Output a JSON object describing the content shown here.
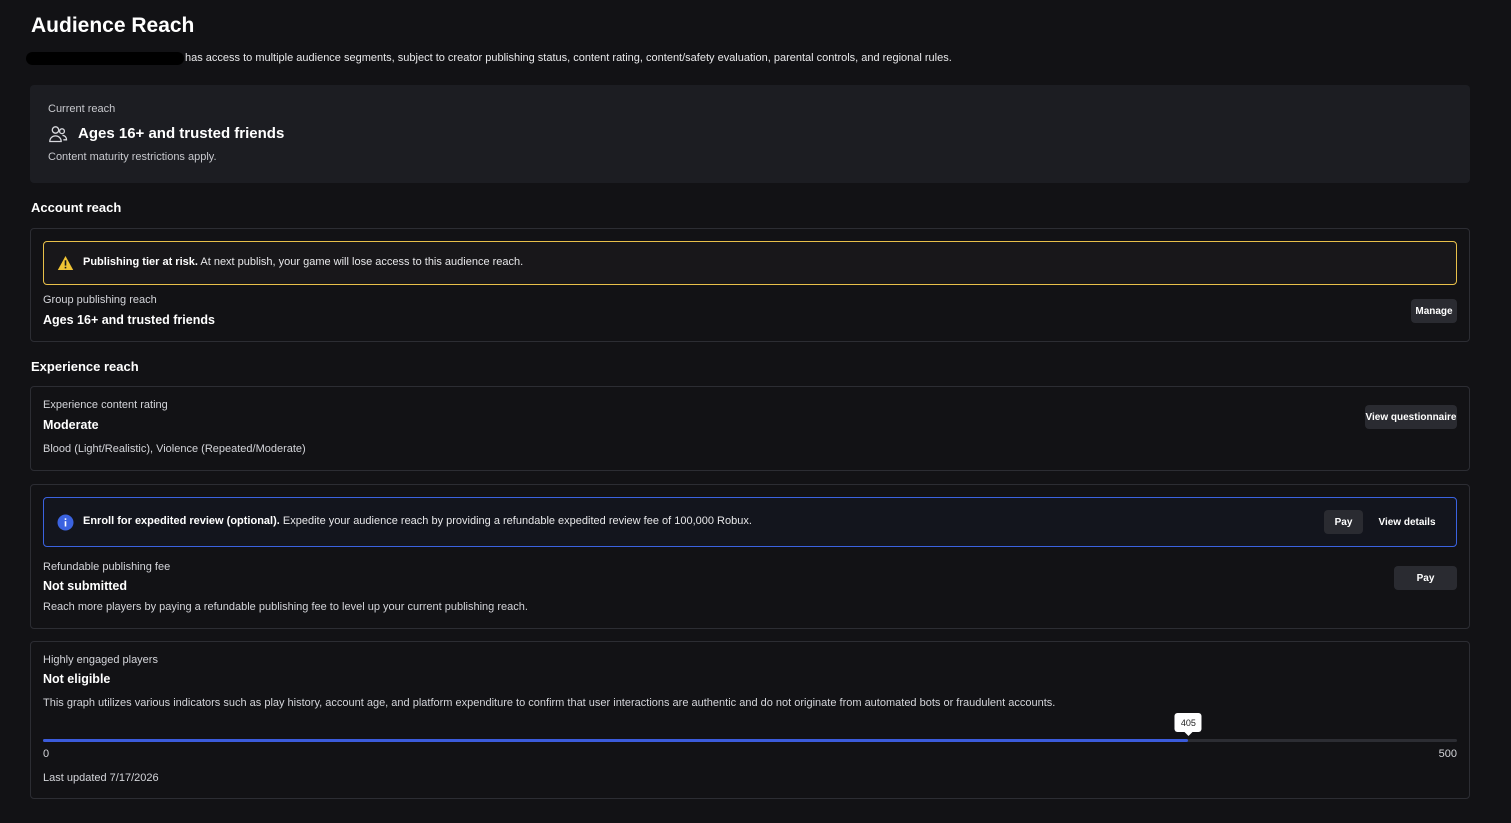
{
  "page": {
    "title": "Audience Reach",
    "subtitle": "has access to multiple audience segments, subject to creator publishing status, content rating, content/safety evaluation, parental controls, and regional rules."
  },
  "current_reach": {
    "label": "Current reach",
    "icon": "people-icon",
    "value": "Ages 16+ and trusted friends",
    "note": "Content maturity restrictions apply."
  },
  "account_reach": {
    "heading": "Account reach",
    "warning": {
      "icon": "warning-icon",
      "color": "#e8c04a",
      "title": "Publishing tier at risk.",
      "text": "At next publish, your game will lose access to this audience reach."
    },
    "label": "Group publishing reach",
    "value": "Ages 16+ and trusted friends",
    "manage_label": "Manage"
  },
  "experience_reach": {
    "heading": "Experience reach",
    "label": "Experience content rating",
    "value": "Moderate",
    "descriptors": "Blood (Light/Realistic), Violence (Repeated/Moderate)",
    "view_questionnaire_label": "View questionnaire"
  },
  "publishing_fee": {
    "info": {
      "icon": "info-icon",
      "color": "#3b63e0",
      "title": "Enroll for expedited review (optional).",
      "text": "Expedite your audience reach by providing a refundable expedited review fee of 100,000 Robux.",
      "pay_label": "Pay",
      "details_label": "View details"
    },
    "label": "Refundable publishing fee",
    "value": "Not submitted",
    "description": "Reach more players by paying a refundable publishing fee to level up your current publishing reach.",
    "pay_label": "Pay"
  },
  "engaged_players": {
    "label": "Highly engaged players",
    "value": "Not eligible",
    "description": "This graph utilizes various indicators such as play history, account age, and platform expenditure to confirm that user interactions are authentic and do not originate from automated bots or fraudulent accounts.",
    "progress": {
      "min": 0,
      "max": 500,
      "current": 405,
      "min_label": "0",
      "max_label": "500",
      "current_label": "405"
    },
    "last_updated": "Last updated 7/17/2026"
  }
}
